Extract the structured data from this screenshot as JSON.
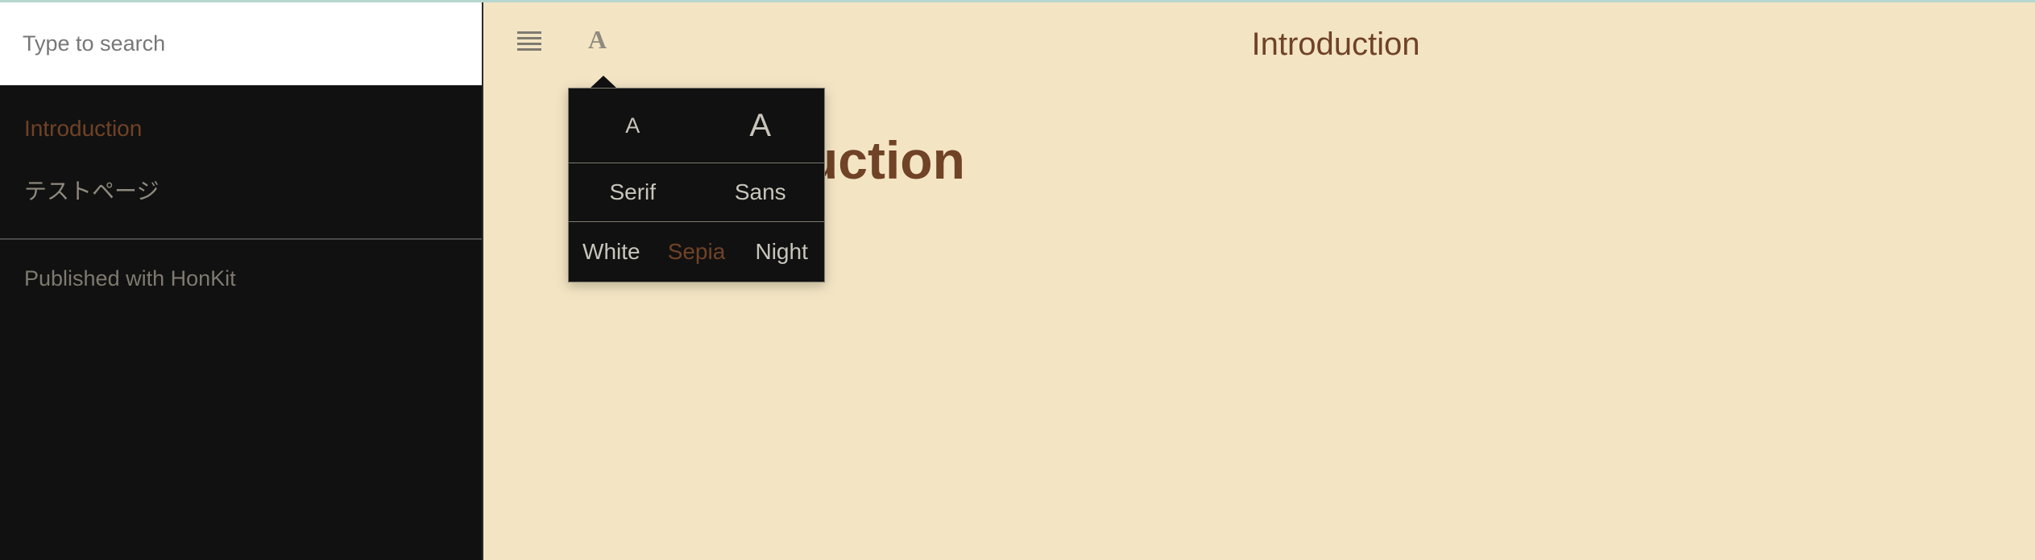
{
  "search": {
    "placeholder": "Type to search"
  },
  "sidebar": {
    "items": [
      {
        "label": "Introduction",
        "active": true
      },
      {
        "label": "テストページ",
        "active": false
      }
    ],
    "published_label": "Published with HonKit"
  },
  "header": {
    "summary_toggle_icon": "hamburger-icon",
    "font_settings_label": "A",
    "title": "Introduction"
  },
  "page": {
    "heading": "Introduction"
  },
  "font_settings": {
    "size_small_label": "A",
    "size_large_label": "A",
    "family_serif_label": "Serif",
    "family_sans_label": "Sans",
    "theme_white_label": "White",
    "theme_sepia_label": "Sepia",
    "theme_night_label": "Night",
    "active_theme": "Sepia"
  },
  "colors": {
    "sidebar_bg": "#111111",
    "main_bg": "#f3e5c4",
    "accent": "#704226",
    "muted_text": "#8f8a7e"
  }
}
